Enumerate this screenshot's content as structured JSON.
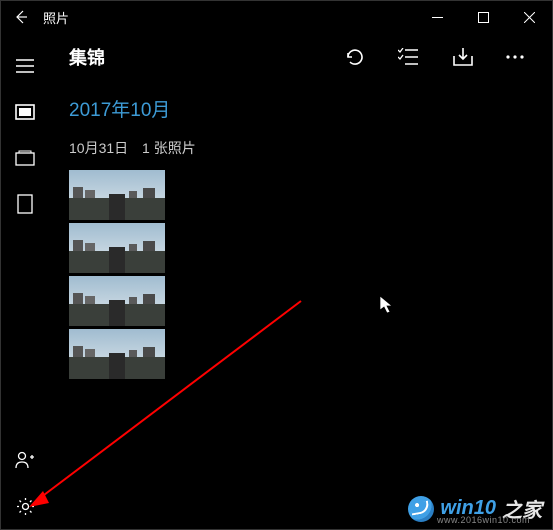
{
  "titlebar": {
    "app": "照片"
  },
  "main": {
    "title": "集锦",
    "month": "2017年10月",
    "day": "10月31日",
    "count": "1 张照片"
  },
  "watermark": {
    "brand1": "win10",
    "brand2": "之家",
    "url": "www.2016win10.com"
  }
}
